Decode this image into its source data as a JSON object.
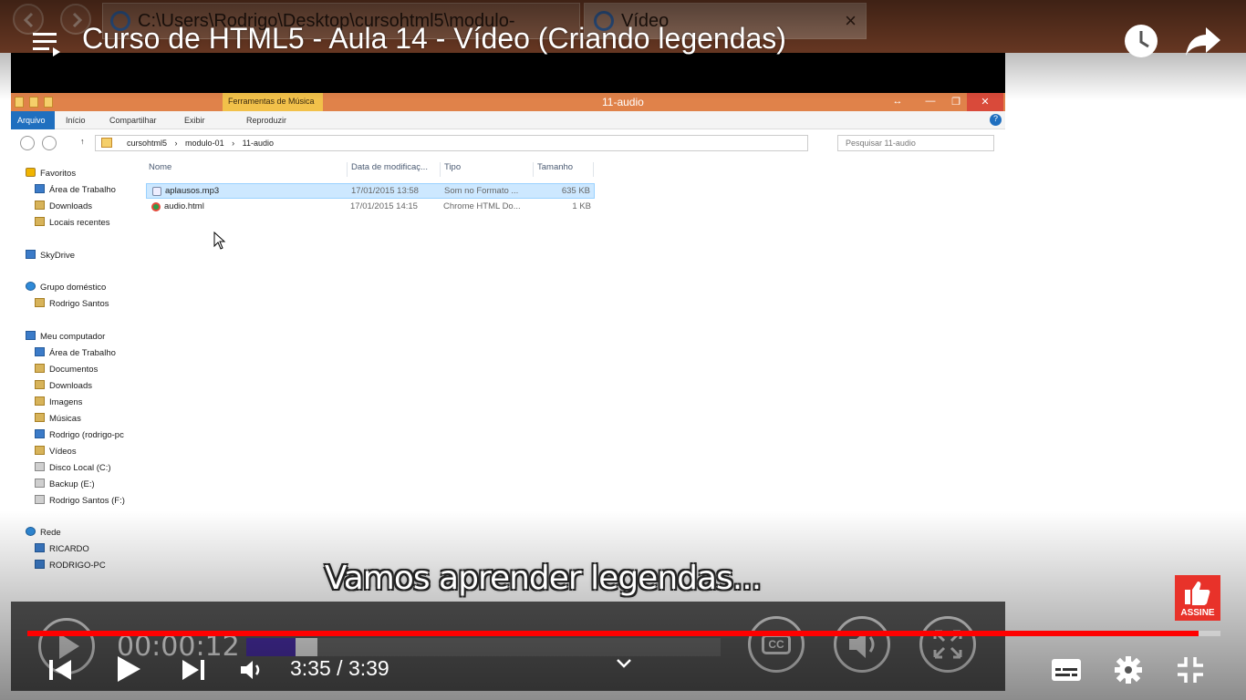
{
  "browser": {
    "address": "C:\\Users\\Rodrigo\\Desktop\\cursohtml5\\modulo-",
    "tab_title": "Vídeo",
    "tab_close": "×"
  },
  "video": {
    "title": "Curso de HTML5 - Aula 14 - Vídeo (Criando legendas)",
    "subtitle": "Vamos aprender legendas...",
    "time_current": "3:35",
    "time_separator": " / ",
    "time_total": "3:39",
    "progress_fraction": 0.982
  },
  "explorer": {
    "window_title": "11-audio",
    "contextual_tab": "Ferramentas de Música",
    "window_buttons": [
      "↔",
      "—",
      "❐",
      "✕"
    ],
    "ribbon": {
      "file_tab": "Arquivo",
      "tabs": [
        "Início",
        "Compartilhar",
        "Exibir"
      ],
      "contextual_item": "Reproduzir",
      "help": "?"
    },
    "path": [
      "cursohtml5",
      "modulo-01",
      "11-audio"
    ],
    "search_placeholder": "Pesquisar 11-audio",
    "sidebar": {
      "favorites": "Favoritos",
      "favorites_items": [
        "Área de Trabalho",
        "Downloads",
        "Locais recentes"
      ],
      "skydrive": "SkyDrive",
      "homegroup": "Grupo doméstico",
      "homegroup_items": [
        "Rodrigo Santos"
      ],
      "computer": "Meu computador",
      "computer_items": [
        "Área de Trabalho",
        "Documentos",
        "Downloads",
        "Imagens",
        "Músicas",
        "Rodrigo (rodrigo-pc",
        "Vídeos",
        "Disco Local (C:)",
        "Backup (E:)",
        "Rodrigo Santos (F:)"
      ],
      "network": "Rede",
      "network_items": [
        "RICARDO",
        "RODRIGO-PC"
      ]
    },
    "columns": [
      "Nome",
      "Data de modificaç...",
      "Tipo",
      "Tamanho"
    ],
    "files": [
      {
        "name": "aplausos.mp3",
        "date": "17/01/2015 13:58",
        "type": "Som no Formato ...",
        "size": "635 KB"
      },
      {
        "name": "audio.html",
        "date": "17/01/2015 14:15",
        "type": "Chrome HTML Do...",
        "size": "1 KB"
      }
    ]
  },
  "inner_player": {
    "time": "00:00:12",
    "cc_label": "CC",
    "progress_fraction": 0.104
  },
  "assine": {
    "label": "ASSINE"
  },
  "colors": {
    "progress_red": "#ff0000",
    "assine_red": "#e8322a",
    "explorer_titlebar": "#e0824a",
    "contextual_tab": "#f2c14a",
    "inner_progress_played": "#4a2fa8"
  },
  "icons": [
    "playlist-icon",
    "watch-later-clock-icon",
    "share-arrow-icon",
    "previous-icon",
    "play-icon",
    "next-icon",
    "volume-icon",
    "chevron-down-icon",
    "subtitles-icon",
    "settings-gear-icon",
    "exit-fullscreen-icon",
    "thumbs-up-icon"
  ]
}
